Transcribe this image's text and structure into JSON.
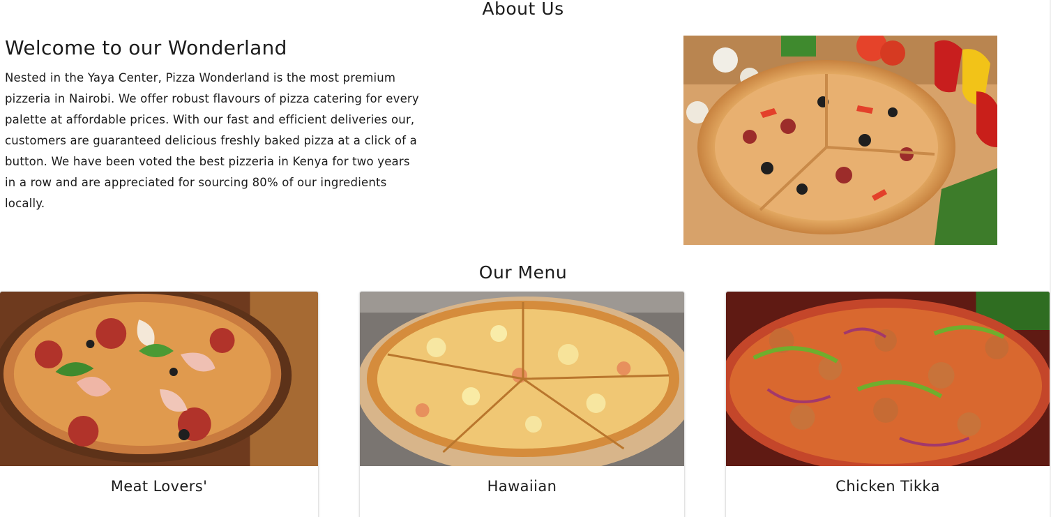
{
  "about": {
    "heading": "About Us",
    "title": "Welcome to our Wonderland",
    "body": "Nested in the Yaya Center, Pizza Wonderland is the most premium pizzeria in Nairobi. We offer robust flavours of pizza catering for every palette at affordable prices. With our fast and efficient deliveries our, customers are guaranteed delicious freshly baked pizza at a click of a button. We have been voted the best pizzeria in Kenya for two years in a row and are appreciated for sourcing 80% of our ingredients locally.",
    "image_icon": "pizza-photo"
  },
  "menu": {
    "heading": "Our Menu",
    "items": [
      {
        "name": "Meat Lovers'",
        "image_icon": "meat-lovers-pizza-photo"
      },
      {
        "name": "Hawaiian",
        "image_icon": "hawaiian-pizza-photo"
      },
      {
        "name": "Chicken Tikka",
        "image_icon": "chicken-tikka-pizza-photo"
      }
    ]
  },
  "colors": {
    "text": "#1b1b1b",
    "background": "#ffffff",
    "card_border": "#e3e3e3"
  }
}
